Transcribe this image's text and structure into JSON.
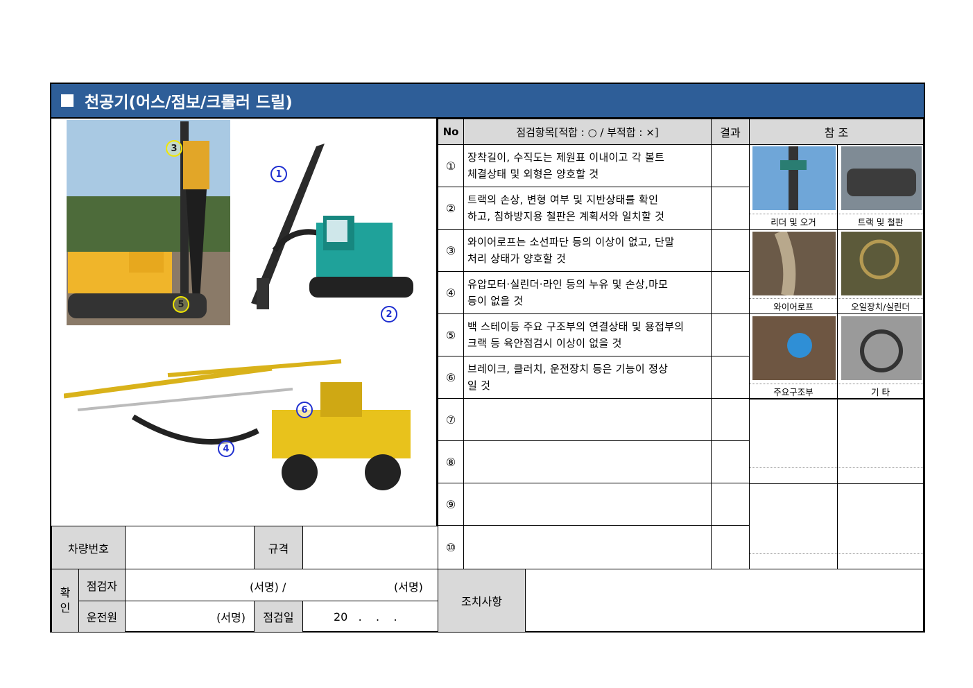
{
  "title": "천공기(어스/점보/크롤러 드릴)",
  "markers": [
    "1",
    "2",
    "3",
    "4",
    "5",
    "6"
  ],
  "header": {
    "no": "No",
    "item": "점검항목[적합 : ○ / 부적합 : ×]",
    "result": "결과",
    "ref": "참 조"
  },
  "items": [
    {
      "no": "①",
      "text": "장착길이, 수직도는 제원표 이내이고 각 볼트\n체결상태 및 외형은 양호할 것"
    },
    {
      "no": "②",
      "text": "트랙의 손상, 변형 여부 및 지반상태를 확인\n하고, 침하방지용 철판은 계획서와 일치할 것"
    },
    {
      "no": "③",
      "text": "와이어로프는 소선파단 등의 이상이 없고, 단말\n처리 상태가 양호할 것"
    },
    {
      "no": "④",
      "text": "유압모터‧실린더‧라인 등의 누유 및 손상,마모\n등이 없을 것"
    },
    {
      "no": "⑤",
      "text": "백 스테이등 주요 구조부의 연결상태 및 용접부의\n크랙 등 육안점검시 이상이 없을 것"
    },
    {
      "no": "⑥",
      "text": "브레이크, 클러치, 운전장치 등은 기능이 정상\n일 것"
    },
    {
      "no": "⑦",
      "text": ""
    },
    {
      "no": "⑧",
      "text": ""
    },
    {
      "no": "⑨",
      "text": ""
    },
    {
      "no": "⑩",
      "text": ""
    }
  ],
  "refs": [
    "리더 및 오거",
    "트랙 및 철판",
    "와이어로프",
    "오일장치/실린더",
    "주요구조부",
    "기 타"
  ],
  "bottom": {
    "vehicle_no": "차량번호",
    "spec": "규격",
    "confirm": "확\n인",
    "inspector": "점검자",
    "sign1": "(서명) /",
    "sign2": "(서명)",
    "driver": "운전원",
    "sign3": "(서명)",
    "date_label": "점검일",
    "date_value": "20   .    .    .",
    "action": "조치사항"
  },
  "colors": {
    "title_bg": "#2e5e98",
    "header_bg": "#d9d9d9"
  }
}
